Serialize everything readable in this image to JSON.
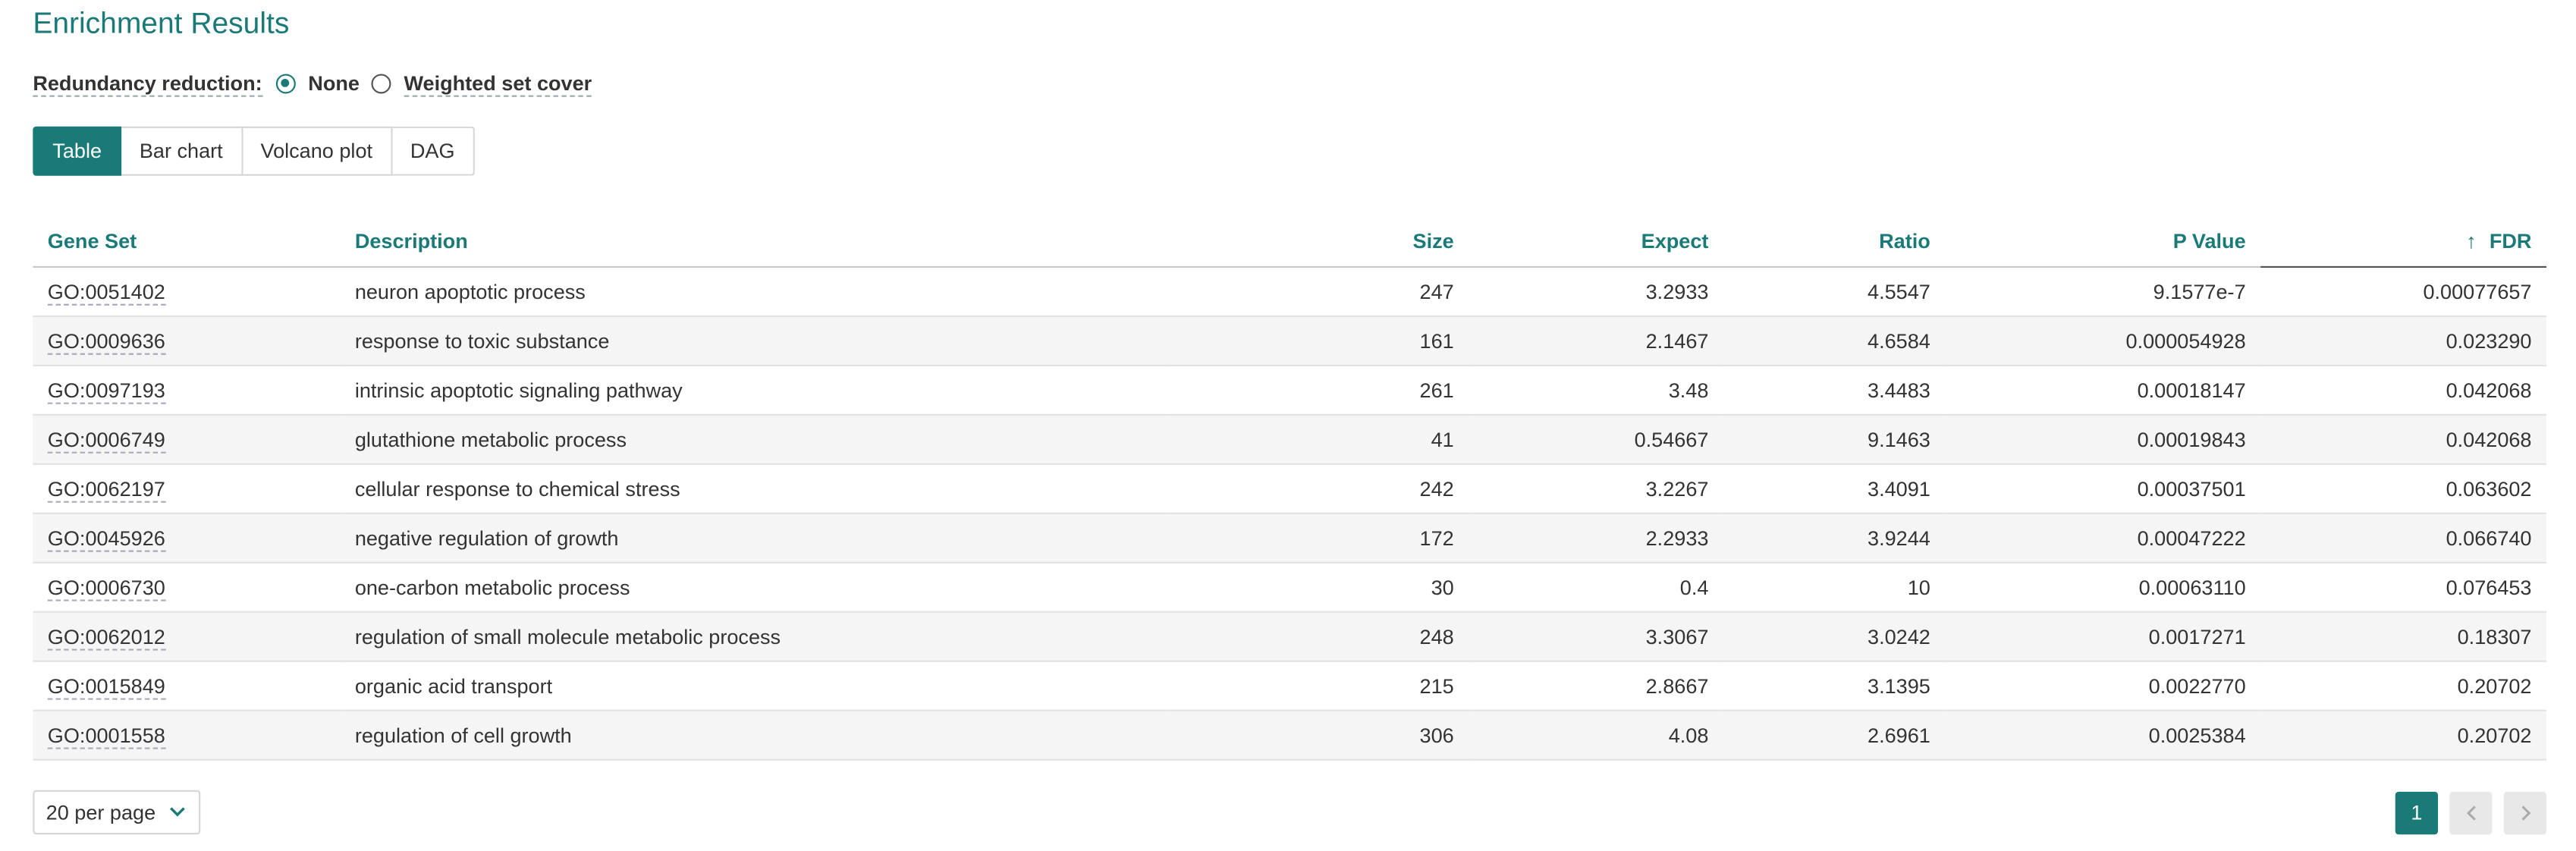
{
  "title": "Enrichment Results",
  "redundancy": {
    "label": "Redundancy reduction:",
    "options": [
      "None",
      "Weighted set cover"
    ],
    "selected": "None"
  },
  "tabs": [
    "Table",
    "Bar chart",
    "Volcano plot",
    "DAG"
  ],
  "active_tab": "Table",
  "table": {
    "headers": [
      "Gene Set",
      "Description",
      "Size",
      "Expect",
      "Ratio",
      "P Value",
      "FDR"
    ],
    "sort_arrow": "↑",
    "rows": [
      [
        "GO:0051402",
        "neuron apoptotic process",
        "247",
        "3.2933",
        "4.5547",
        "9.1577e-7",
        "0.00077657"
      ],
      [
        "GO:0009636",
        "response to toxic substance",
        "161",
        "2.1467",
        "4.6584",
        "0.000054928",
        "0.023290"
      ],
      [
        "GO:0097193",
        "intrinsic apoptotic signaling pathway",
        "261",
        "3.48",
        "3.4483",
        "0.00018147",
        "0.042068"
      ],
      [
        "GO:0006749",
        "glutathione metabolic process",
        "41",
        "0.54667",
        "9.1463",
        "0.00019843",
        "0.042068"
      ],
      [
        "GO:0062197",
        "cellular response to chemical stress",
        "242",
        "3.2267",
        "3.4091",
        "0.00037501",
        "0.063602"
      ],
      [
        "GO:0045926",
        "negative regulation of growth",
        "172",
        "2.2933",
        "3.9244",
        "0.00047222",
        "0.066740"
      ],
      [
        "GO:0006730",
        "one-carbon metabolic process",
        "30",
        "0.4",
        "10",
        "0.00063110",
        "0.076453"
      ],
      [
        "GO:0062012",
        "regulation of small molecule metabolic process",
        "248",
        "3.3067",
        "3.0242",
        "0.0017271",
        "0.18307"
      ],
      [
        "GO:0015849",
        "organic acid transport",
        "215",
        "2.8667",
        "3.1395",
        "0.0022770",
        "0.20702"
      ],
      [
        "GO:0001558",
        "regulation of cell growth",
        "306",
        "4.08",
        "2.6961",
        "0.0025384",
        "0.20702"
      ]
    ]
  },
  "pagination": {
    "per_page": "20 per page",
    "current_page": "1"
  },
  "colors": {
    "accent": "#1a7a78",
    "row_alt": "#f5f5f5"
  }
}
